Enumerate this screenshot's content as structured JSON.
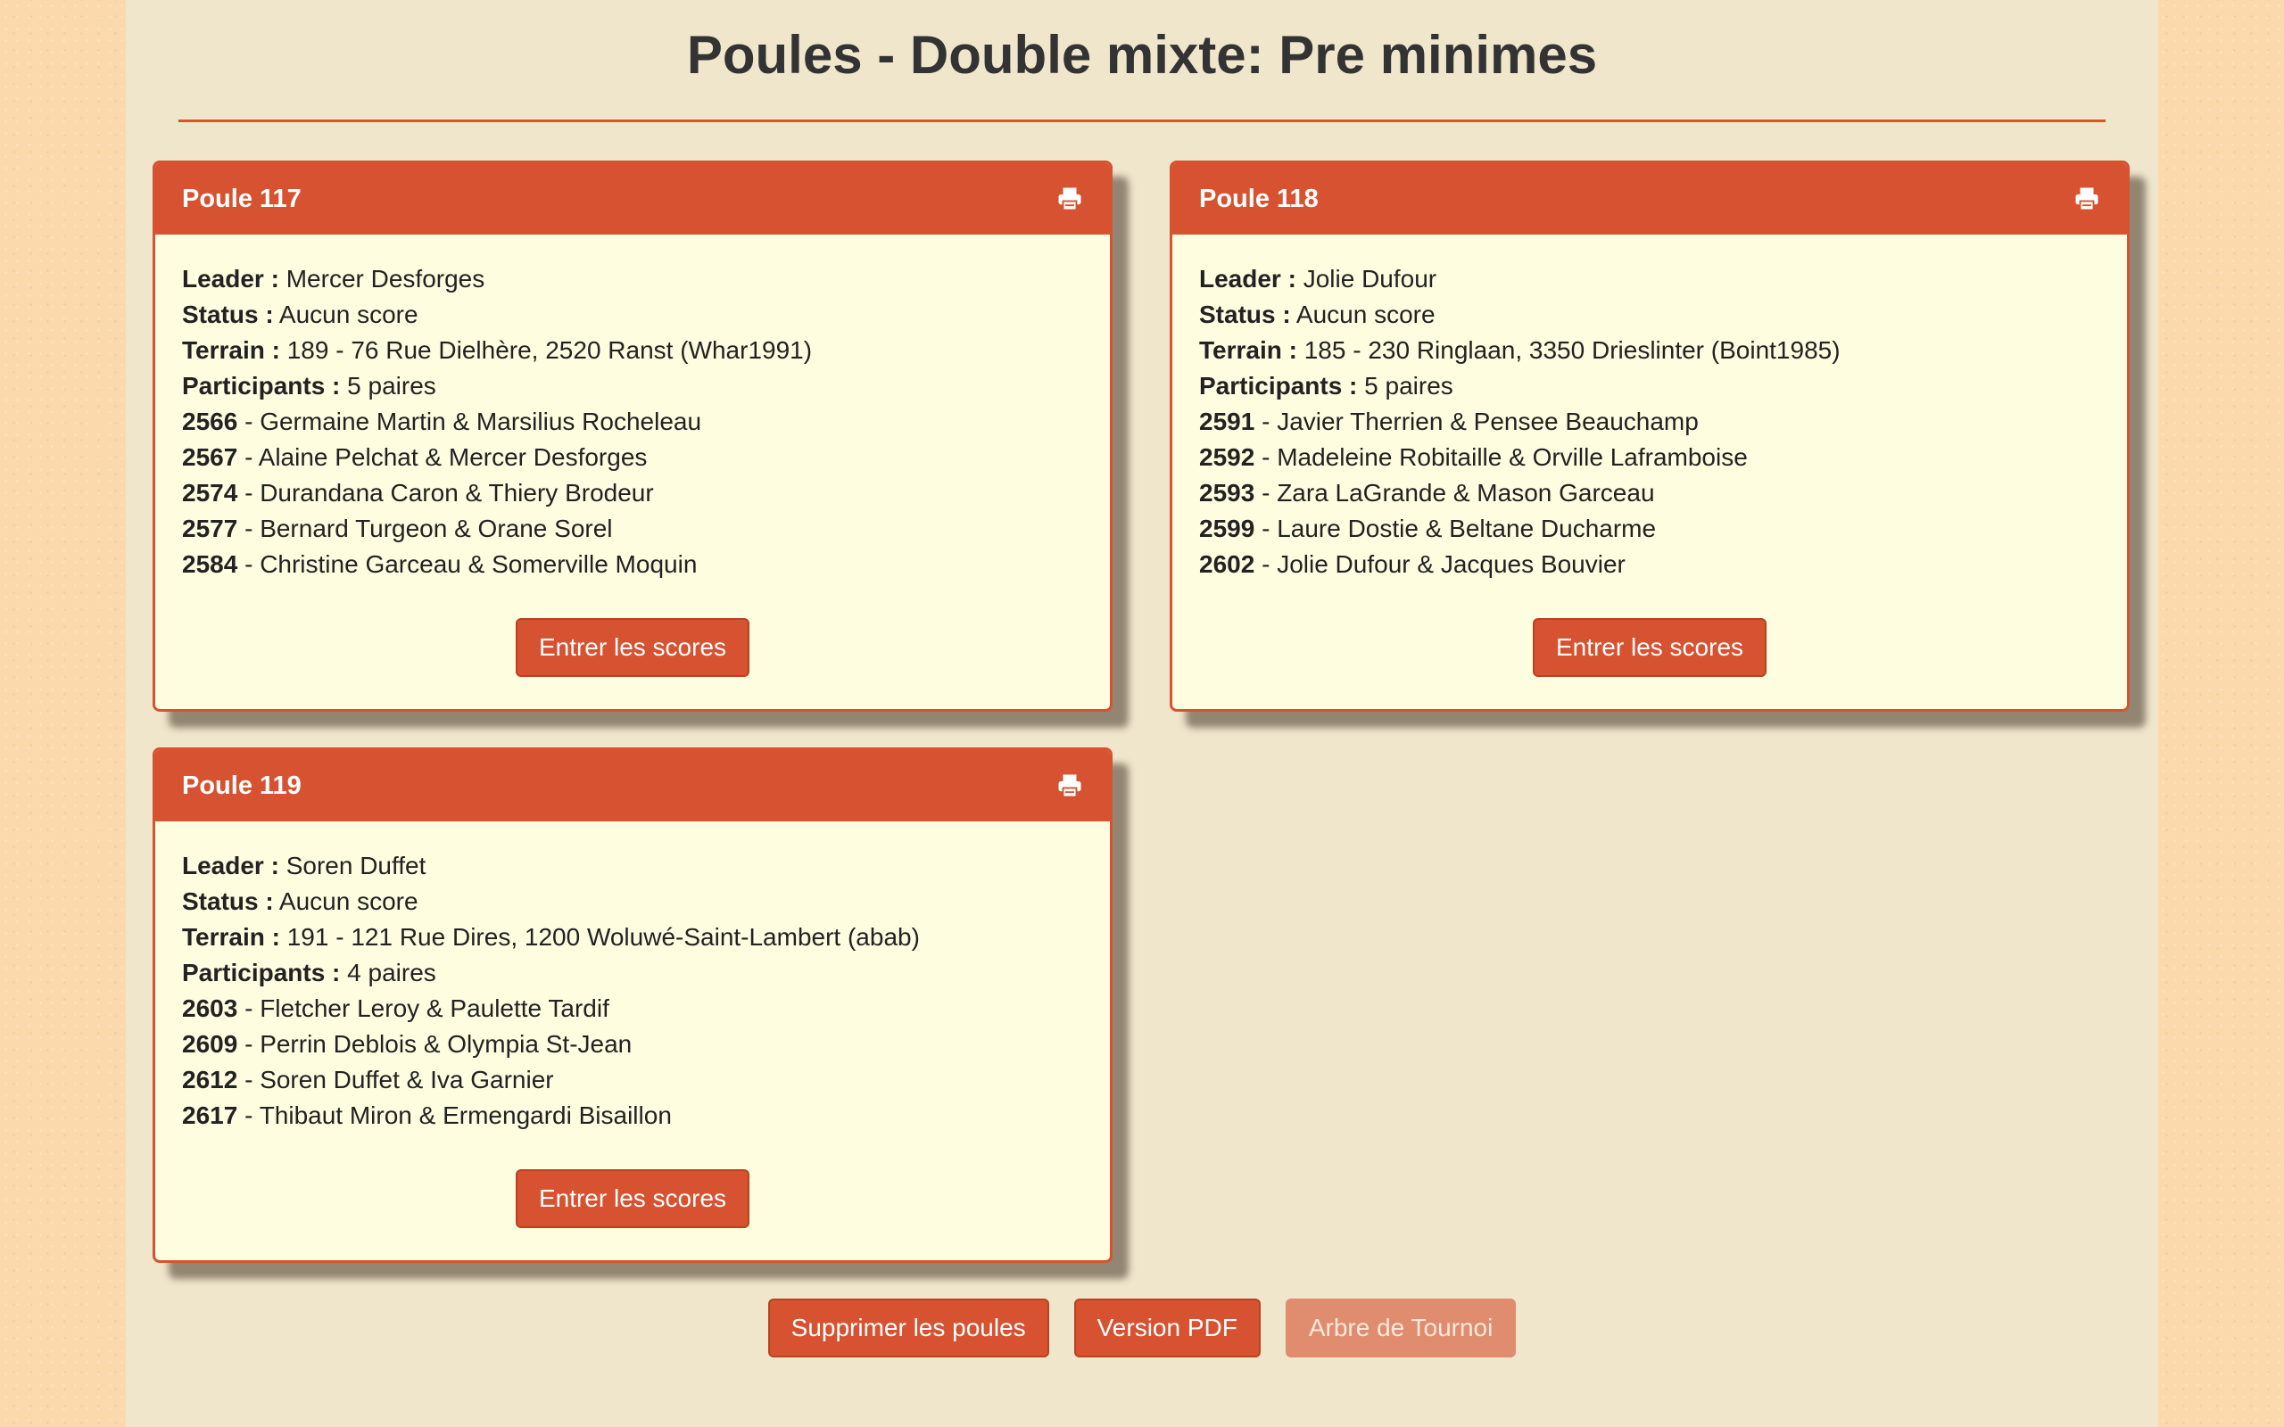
{
  "page": {
    "title": "Poules - Double mixte: Pre minimes"
  },
  "labels": {
    "leader": "Leader :",
    "status": "Status :",
    "terrain": "Terrain :",
    "participants": "Participants :",
    "separator": " - "
  },
  "poules": [
    {
      "title": "Poule 117",
      "leader": "Mercer Desforges",
      "status": "Aucun score",
      "terrain": "189 - 76 Rue Dielhère, 2520 Ranst (Whar1991)",
      "participants": "5 paires",
      "pairs": [
        {
          "id": "2566",
          "names": "Germaine Martin & Marsilius Rocheleau"
        },
        {
          "id": "2567",
          "names": "Alaine Pelchat & Mercer Desforges"
        },
        {
          "id": "2574",
          "names": "Durandana Caron & Thiery Brodeur"
        },
        {
          "id": "2577",
          "names": "Bernard Turgeon & Orane Sorel"
        },
        {
          "id": "2584",
          "names": "Christine Garceau & Somerville Moquin"
        }
      ],
      "button": "Entrer les scores"
    },
    {
      "title": "Poule 118",
      "leader": "Jolie Dufour",
      "status": "Aucun score",
      "terrain": "185 - 230 Ringlaan, 3350 Drieslinter (Boint1985)",
      "participants": "5 paires",
      "pairs": [
        {
          "id": "2591",
          "names": "Javier Therrien & Pensee Beauchamp"
        },
        {
          "id": "2592",
          "names": "Madeleine Robitaille & Orville Laframboise"
        },
        {
          "id": "2593",
          "names": "Zara LaGrande & Mason Garceau"
        },
        {
          "id": "2599",
          "names": "Laure Dostie & Beltane Ducharme"
        },
        {
          "id": "2602",
          "names": "Jolie Dufour & Jacques Bouvier"
        }
      ],
      "button": "Entrer les scores"
    },
    {
      "title": "Poule 119",
      "leader": "Soren Duffet",
      "status": "Aucun score",
      "terrain": "191 - 121 Rue Dires, 1200 Woluwé-Saint-Lambert (abab)",
      "participants": "4 paires",
      "pairs": [
        {
          "id": "2603",
          "names": "Fletcher Leroy & Paulette Tardif"
        },
        {
          "id": "2609",
          "names": "Perrin Deblois & Olympia St-Jean"
        },
        {
          "id": "2612",
          "names": "Soren Duffet & Iva Garnier"
        },
        {
          "id": "2617",
          "names": "Thibaut Miron & Ermengardi Bisaillon"
        }
      ],
      "button": "Entrer les scores"
    }
  ],
  "actions": {
    "delete": "Supprimer les poules",
    "pdf": "Version PDF",
    "tree": "Arbre de Tournoi"
  },
  "icons": {
    "card_header": "print-icon"
  },
  "colors": {
    "accent": "#d65230",
    "card_background": "#fefde0",
    "page_background": "#efe6cc",
    "outer_background": "#fcd9ad",
    "disabled_button": "#e08c6f"
  }
}
